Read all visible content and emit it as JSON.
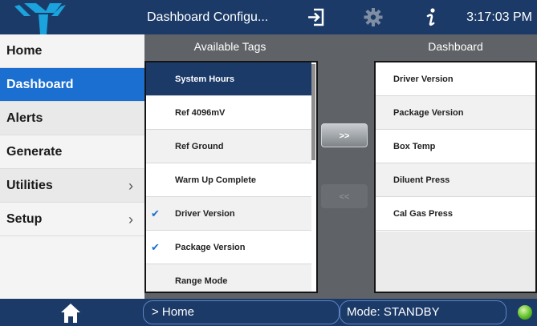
{
  "header": {
    "title": "Dashboard Configu...",
    "time": "3:17:03 PM",
    "icons": [
      "logo-icon",
      "exit-icon",
      "gear-icon",
      "info-icon"
    ]
  },
  "sidebar": {
    "items": [
      {
        "label": "Home",
        "chevron": ""
      },
      {
        "label": "Dashboard",
        "chevron": ""
      },
      {
        "label": "Alerts",
        "chevron": ""
      },
      {
        "label": "Generate",
        "chevron": ""
      },
      {
        "label": "Utilities",
        "chevron": "›"
      },
      {
        "label": "Setup",
        "chevron": "›"
      }
    ]
  },
  "available": {
    "title": "Available Tags",
    "rows": [
      {
        "label": "System Hours",
        "check": ""
      },
      {
        "label": "Ref 4096mV",
        "check": ""
      },
      {
        "label": "Ref Ground",
        "check": ""
      },
      {
        "label": "Warm Up Complete",
        "check": ""
      },
      {
        "label": "Driver Version",
        "check": "✔"
      },
      {
        "label": "Package Version",
        "check": "✔"
      },
      {
        "label": "Range Mode",
        "check": ""
      }
    ]
  },
  "dashboard": {
    "title": "Dashboard",
    "rows": [
      {
        "label": "Driver Version"
      },
      {
        "label": "Package Version"
      },
      {
        "label": "Box Temp"
      },
      {
        "label": "Diluent Press"
      },
      {
        "label": "Cal Gas Press"
      }
    ]
  },
  "buttons": {
    "add": ">>",
    "remove": "<<"
  },
  "footer": {
    "path": "> Home",
    "mode": "Mode: STANDBY"
  },
  "colors": {
    "header_bg": "#1b3a68",
    "active": "#1a6fd1",
    "body_bg": "#5f6367",
    "status_led": "#5fbf2a"
  }
}
